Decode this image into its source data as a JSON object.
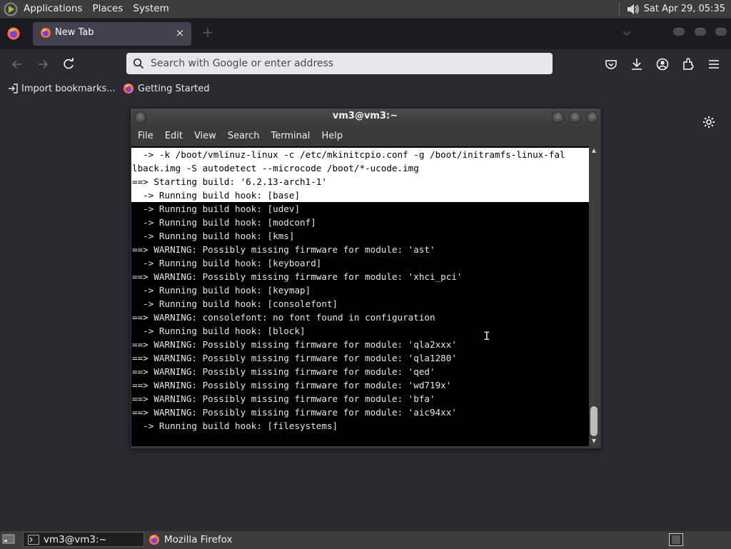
{
  "top_panel": {
    "menus": [
      "Applications",
      "Places",
      "System"
    ],
    "clock": "Sat Apr 29, 05:35",
    "icons": [
      "distro-logo-icon",
      "volume-icon"
    ]
  },
  "browser": {
    "tab": {
      "title": "New Tab",
      "close": "×"
    },
    "new_tab": "+",
    "url_placeholder": "Search with Google or enter address",
    "bookmarks": [
      {
        "label": "Import bookmarks..."
      },
      {
        "label": "Getting Started"
      }
    ],
    "toolbar_icons": [
      "back-icon",
      "forward-icon",
      "reload-icon",
      "pocket-icon",
      "download-icon",
      "account-icon",
      "extensions-icon",
      "menu-icon"
    ]
  },
  "terminal": {
    "title": "vm3@vm3:~",
    "menu": [
      "File",
      "Edit",
      "View",
      "Search",
      "Terminal",
      "Help"
    ],
    "lines": [
      {
        "text": "  -> -k /boot/vmlinuz-linux -c /etc/mkinitcpio.conf -g /boot/initramfs-linux-fal",
        "selected": true
      },
      {
        "text": "lback.img -S autodetect --microcode /boot/*-ucode.img",
        "selected": true
      },
      {
        "text": "==> Starting build: '6.2.13-arch1-1'",
        "selected": true
      },
      {
        "text": "  -> Running build hook: [base]",
        "selected": true
      },
      {
        "text": "  -> Running build hook: [udev]",
        "selected": false
      },
      {
        "text": "  -> Running build hook: [modconf]",
        "selected": false
      },
      {
        "text": "  -> Running build hook: [kms]",
        "selected": false
      },
      {
        "text": "==> WARNING: Possibly missing firmware for module: 'ast'",
        "selected": false
      },
      {
        "text": "  -> Running build hook: [keyboard]",
        "selected": false
      },
      {
        "text": "==> WARNING: Possibly missing firmware for module: 'xhci_pci'",
        "selected": false
      },
      {
        "text": "  -> Running build hook: [keymap]",
        "selected": false
      },
      {
        "text": "  -> Running build hook: [consolefont]",
        "selected": false
      },
      {
        "text": "==> WARNING: consolefont: no font found in configuration",
        "selected": false
      },
      {
        "text": "  -> Running build hook: [block]",
        "selected": false
      },
      {
        "text": "==> WARNING: Possibly missing firmware for module: 'qla2xxx'",
        "selected": false
      },
      {
        "text": "==> WARNING: Possibly missing firmware for module: 'qla1280'",
        "selected": false
      },
      {
        "text": "==> WARNING: Possibly missing firmware for module: 'qed'",
        "selected": false
      },
      {
        "text": "==> WARNING: Possibly missing firmware for module: 'wd719x'",
        "selected": false
      },
      {
        "text": "==> WARNING: Possibly missing firmware for module: 'bfa'",
        "selected": false
      },
      {
        "text": "==> WARNING: Possibly missing firmware for module: 'aic94xx'",
        "selected": false
      },
      {
        "text": "  -> Running build hook: [filesystems]",
        "selected": false
      }
    ]
  },
  "taskbar": {
    "tasks": [
      {
        "label": "vm3@vm3:~",
        "icon": "terminal-icon",
        "active": true
      },
      {
        "label": "Mozilla Firefox",
        "icon": "firefox-icon",
        "active": false
      }
    ]
  },
  "colors": {
    "panel": "#3c3c3c",
    "browser_bg": "#2b2a33",
    "tab_strip": "#1c1b22",
    "urlbar": "#e7e6ea",
    "terminal_bg": "#000000",
    "selection_bg": "#ffffff"
  }
}
